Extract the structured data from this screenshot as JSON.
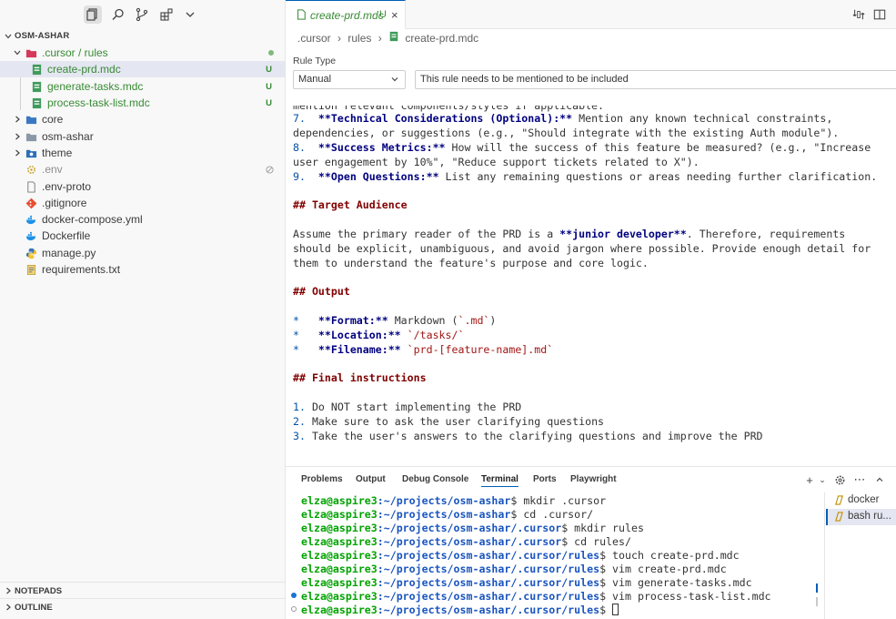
{
  "sidebar": {
    "header": "OSM-ASHAR",
    "tree": {
      "folder_cursor": {
        "label": ".cursor / rules"
      },
      "files_rules": [
        {
          "label": "create-prd.mdc",
          "badge": "U"
        },
        {
          "label": "generate-tasks.mdc",
          "badge": "U"
        },
        {
          "label": "process-task-list.mdc",
          "badge": "U"
        }
      ],
      "folders": [
        {
          "label": "core"
        },
        {
          "label": "osm-ashar"
        },
        {
          "label": "theme"
        }
      ],
      "files": [
        {
          "label": ".env",
          "icon": "gear-icon"
        },
        {
          "label": ".env-proto",
          "icon": "file-icon"
        },
        {
          "label": ".gitignore",
          "icon": "git-icon"
        },
        {
          "label": "docker-compose.yml",
          "icon": "docker-icon"
        },
        {
          "label": "Dockerfile",
          "icon": "docker-icon"
        },
        {
          "label": "manage.py",
          "icon": "python-icon"
        },
        {
          "label": "requirements.txt",
          "icon": "text-file-icon"
        }
      ]
    },
    "notepads": "NOTEPADS",
    "outline": "OUTLINE"
  },
  "editor": {
    "tab": {
      "label": "create-prd.mdc",
      "status": "U",
      "close": "×"
    },
    "breadcrumb": [
      ".cursor",
      "rules",
      "create-prd.mdc"
    ],
    "breadcrumb_sep": "›",
    "rule_type_label": "Rule Type",
    "rule_type_value": "Manual",
    "rule_description": "This rule needs to be mentioned to be included",
    "code": {
      "l0": "mention relevant components/styles if applicable.",
      "l1a": "7.",
      "l1b": "  **Technical Considerations (Optional):**",
      "l1c": " Mention any known technical constraints,",
      "l2": "dependencies, or suggestions (e.g., \"Should integrate with the existing Auth module\").",
      "l3a": "8.",
      "l3b": "  **Success Metrics:**",
      "l3c": " How will the success of this feature be measured? (e.g., \"Increase",
      "l4": "user engagement by 10%\", \"Reduce support tickets related to X\").",
      "l5a": "9.",
      "l5b": "  **Open Questions:**",
      "l5c": " List any remaining questions or areas needing further clarification.",
      "h1": "## Target Audience",
      "p1a": "Assume the primary reader of the PRD is a ",
      "p1b": "**junior developer**",
      "p1c": ". Therefore, requirements",
      "p2": "should be explicit, unambiguous, and avoid jargon where possible. Provide enough detail for",
      "p3": "them to understand the feature's purpose and core logic.",
      "h2": "## Output",
      "o1a": "*",
      "o1b": "   **Format:**",
      "o1c": " Markdown (",
      "o1d": "`.md`",
      "o1e": ")",
      "o2a": "*",
      "o2b": "   **Location:**",
      "o2c": " ",
      "o2d": "`/tasks/`",
      "o3a": "*",
      "o3b": "   **Filename:**",
      "o3c": " ",
      "o3d": "`prd-[feature-name].md`",
      "h3": "## Final instructions",
      "f1a": "1.",
      "f1b": " Do NOT start implementing the PRD",
      "f2a": "2.",
      "f2b": " Make sure to ask the user clarifying questions",
      "f3a": "3.",
      "f3b": " Take the user's answers to the clarifying questions and improve the PRD"
    }
  },
  "panel": {
    "tabs": [
      "Problems",
      "Output",
      "Debug Console",
      "Terminal",
      "Ports",
      "Playwright"
    ],
    "active_tab": "Terminal",
    "terminal": {
      "user": "elza@aspire3",
      "lines": [
        {
          "path": ":~/projects/osm-ashar",
          "cmd": "$ mkdir .cursor"
        },
        {
          "path": ":~/projects/osm-ashar",
          "cmd": "$ cd .cursor/"
        },
        {
          "path": ":~/projects/osm-ashar/.cursor",
          "cmd": "$ mkdir rules"
        },
        {
          "path": ":~/projects/osm-ashar/.cursor",
          "cmd": "$ cd rules/"
        },
        {
          "path": ":~/projects/osm-ashar/.cursor/rules",
          "cmd": "$ touch create-prd.mdc"
        },
        {
          "path": ":~/projects/osm-ashar/.cursor/rules",
          "cmd": "$ vim create-prd.mdc"
        },
        {
          "path": ":~/projects/osm-ashar/.cursor/rules",
          "cmd": "$ vim generate-tasks.mdc"
        },
        {
          "path": ":~/projects/osm-ashar/.cursor/rules",
          "cmd": "$ vim process-task-list.mdc"
        },
        {
          "path": ":~/projects/osm-ashar/.cursor/rules",
          "cmd": "$ "
        }
      ]
    },
    "terminal_list": [
      {
        "label": "docker"
      },
      {
        "label": "bash ru..."
      }
    ]
  },
  "colors": {
    "accent": "#005fb8",
    "untracked": "#388a34",
    "prompt_user": "#00a300",
    "prompt_path": "#1a55c0"
  }
}
